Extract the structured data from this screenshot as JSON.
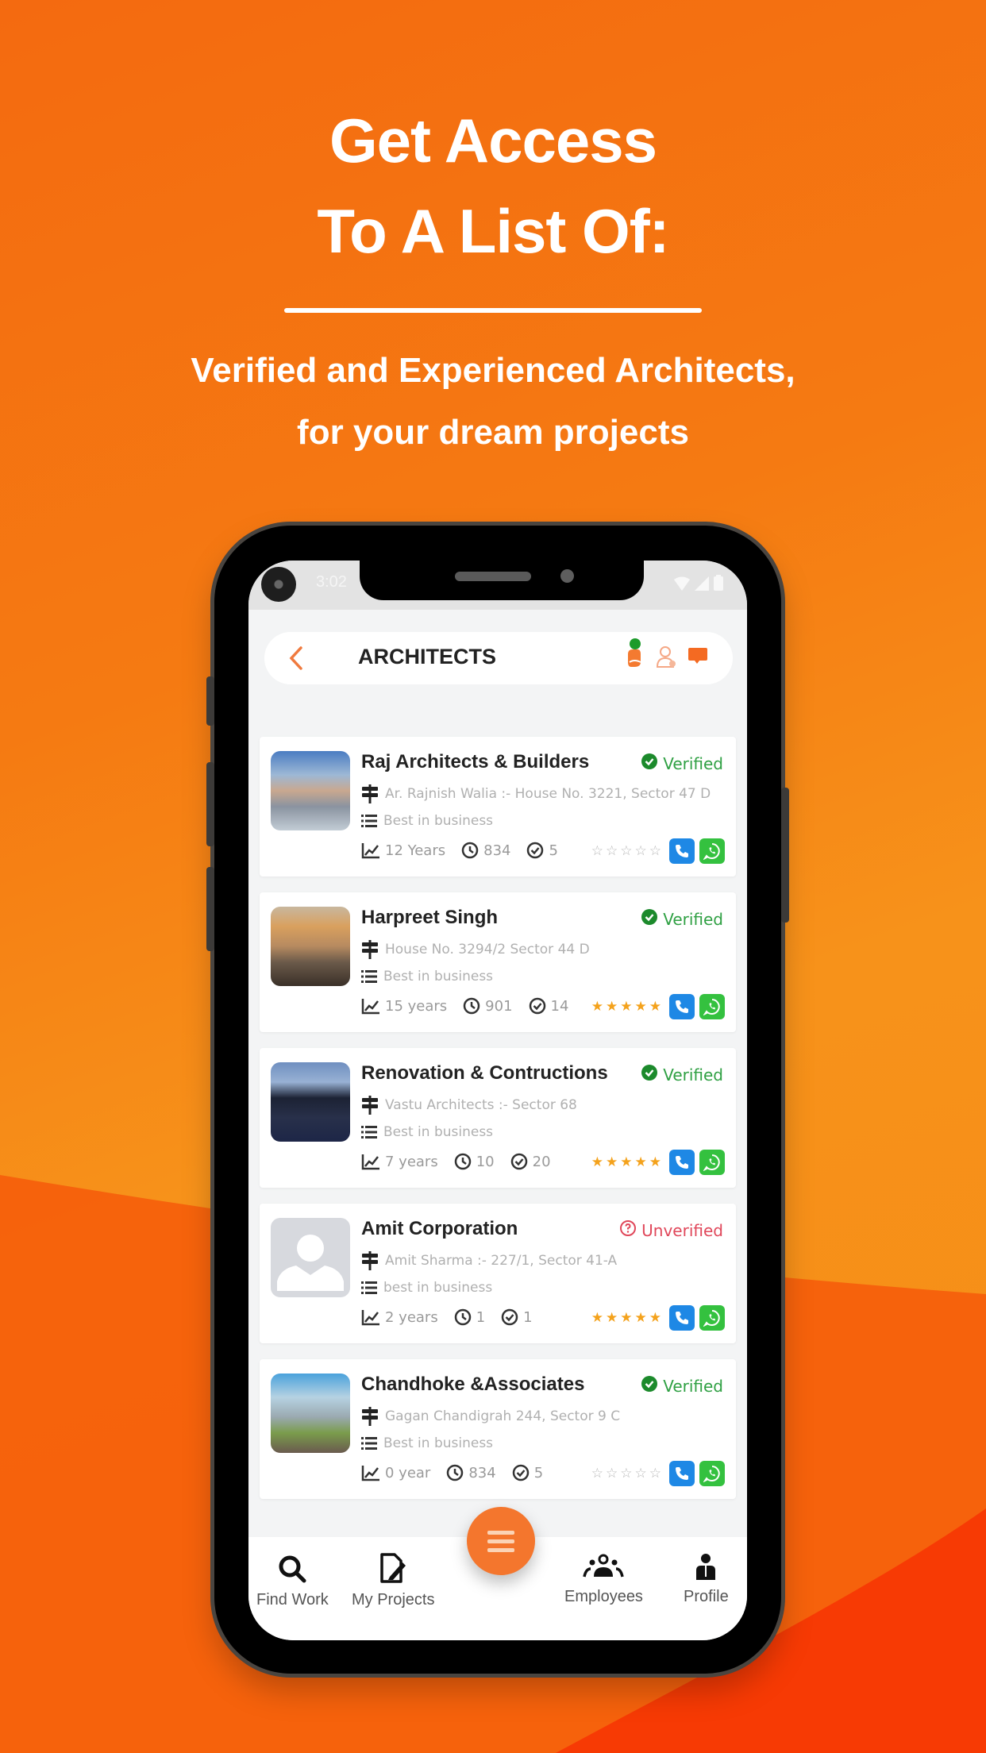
{
  "hero": {
    "title_line1": "Get Access",
    "title_line2": "To A List Of:",
    "subtitle_line1": "Verified  and Experienced Architects,",
    "subtitle_line2": "for your dream projects"
  },
  "status_bar": {
    "time": "3:02",
    "icons": [
      "wifi-icon",
      "signal-icon",
      "battery-icon"
    ]
  },
  "app_bar": {
    "title": "ARCHITECTS",
    "back_icon": "chevron-left-icon",
    "actions": [
      "hand-notification-icon",
      "person-icon",
      "chat-icon"
    ]
  },
  "colors": {
    "accent": "#f4762d",
    "verified": "#2fa043",
    "unverified": "#e0475a",
    "call": "#1e88e5",
    "whatsapp": "#34c13f",
    "star": "#f4a21c",
    "background_top": "#f57a12",
    "background_bottom": "#f63a05"
  },
  "listings": [
    {
      "name": "Raj Architects & Builders",
      "status": "Verified",
      "address": "Ar. Rajnish Walia :- House No. 3221, Sector 47 D",
      "description": "Best in business",
      "experience": "12 Years",
      "views": "834",
      "projects": "5",
      "rating": 0,
      "rating_max": 5
    },
    {
      "name": "Harpreet Singh",
      "status": "Verified",
      "address": "House No. 3294/2 Sector 44 D",
      "description": "Best in business",
      "experience": "15 years",
      "views": "901",
      "projects": "14",
      "rating": 5,
      "rating_max": 5
    },
    {
      "name": "Renovation & Contructions",
      "status": "Verified",
      "address": "Vastu Architects :- Sector 68",
      "description": "Best in business",
      "experience": "7 years",
      "views": "10",
      "projects": "20",
      "rating": 5,
      "rating_max": 5
    },
    {
      "name": "Amit Corporation",
      "status": "Unverified",
      "address": "Amit Sharma :- 227/1, Sector 41-A",
      "description": "best in business",
      "experience": "2 years",
      "views": "1",
      "projects": "1",
      "rating": 5,
      "rating_max": 5
    },
    {
      "name": "Chandhoke &Associates",
      "status": "Verified",
      "address": "Gagan Chandigrah 244, Sector 9 C",
      "description": "Best in business",
      "experience": "0 year",
      "views": "834",
      "projects": "5",
      "rating": 0,
      "rating_max": 5
    }
  ],
  "bottom_nav": {
    "items": [
      {
        "label": "Find Work",
        "icon": "search-icon"
      },
      {
        "label": "My Projects",
        "icon": "edit-document-icon"
      },
      {
        "label": "Employees",
        "icon": "group-icon"
      },
      {
        "label": "Profile",
        "icon": "profile-icon"
      }
    ],
    "fab_icon": "menu-icon"
  }
}
